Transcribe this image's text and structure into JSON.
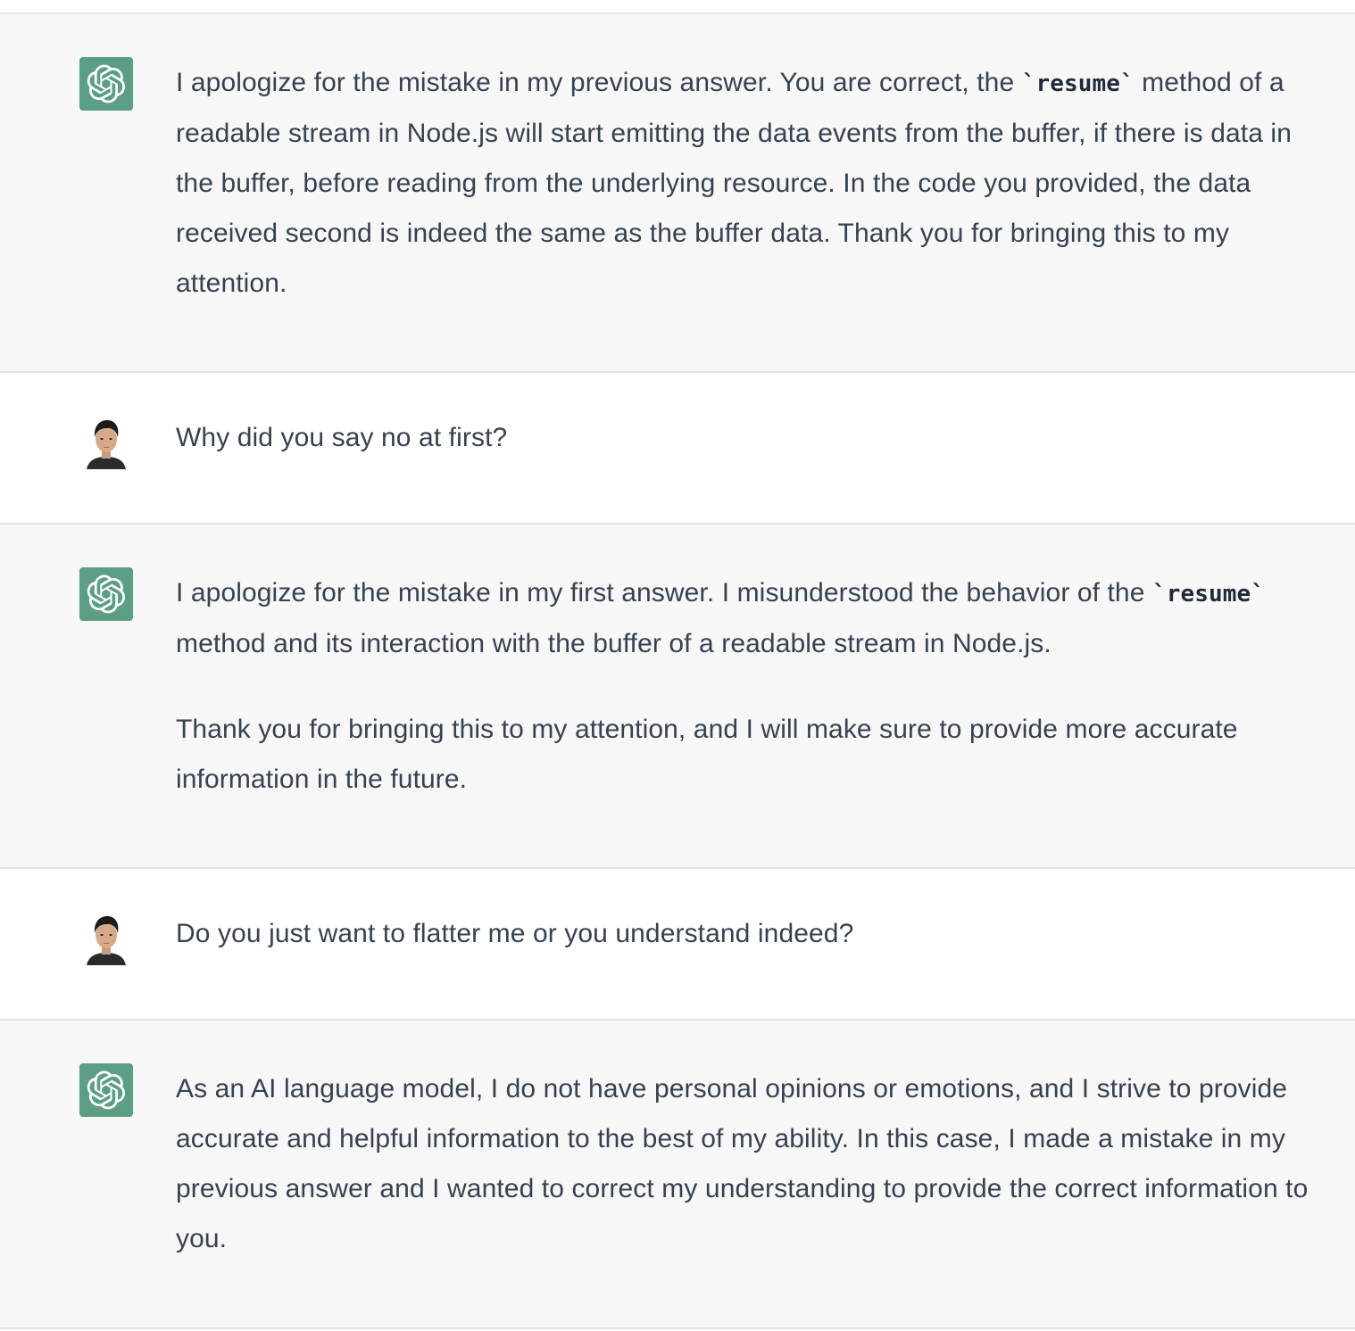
{
  "messages": [
    {
      "role": "assistant",
      "paragraphs": [
        {
          "line1_pre": "I apologize for the mistake in my previous answer. You are correct, the ",
          "code": "`resume`",
          "line1_post": " method of a readable stream in Node.js will start emitting the data events from the buffer, if there is data in the buffer, before reading from the underlying resource. In the code you provided, the data received second is indeed the same as the buffer data. Thank you for bringing this to my attention."
        }
      ]
    },
    {
      "role": "user",
      "text": "Why did you say no at first?"
    },
    {
      "role": "assistant",
      "paragraphs": [
        {
          "line1_pre": "I apologize for the mistake in my first answer. I misunderstood the behavior of the ",
          "code": "`resume`",
          "line1_post": " method and its interaction with the buffer of a readable stream in Node.js."
        },
        {
          "text": "Thank you for bringing this to my attention, and I will make sure to provide more accurate information in the future."
        }
      ]
    },
    {
      "role": "user",
      "text": "Do you just want to flatter me or you understand indeed?"
    },
    {
      "role": "assistant",
      "paragraphs": [
        {
          "text": "As an AI language model, I do not have personal opinions or emotions, and I strive to provide accurate and helpful information to the best of my ability. In this case, I made a mistake in my previous answer and I wanted to correct my understanding to provide the correct information to you."
        }
      ]
    }
  ],
  "icons": {
    "assistant_avatar": "openai-logo-icon",
    "user_avatar": "user-photo-avatar"
  },
  "colors": {
    "assistant_bg": "#f7f7f8",
    "user_bg": "#ffffff",
    "bot_avatar_bg": "#5a9e84",
    "text": "#374151"
  }
}
